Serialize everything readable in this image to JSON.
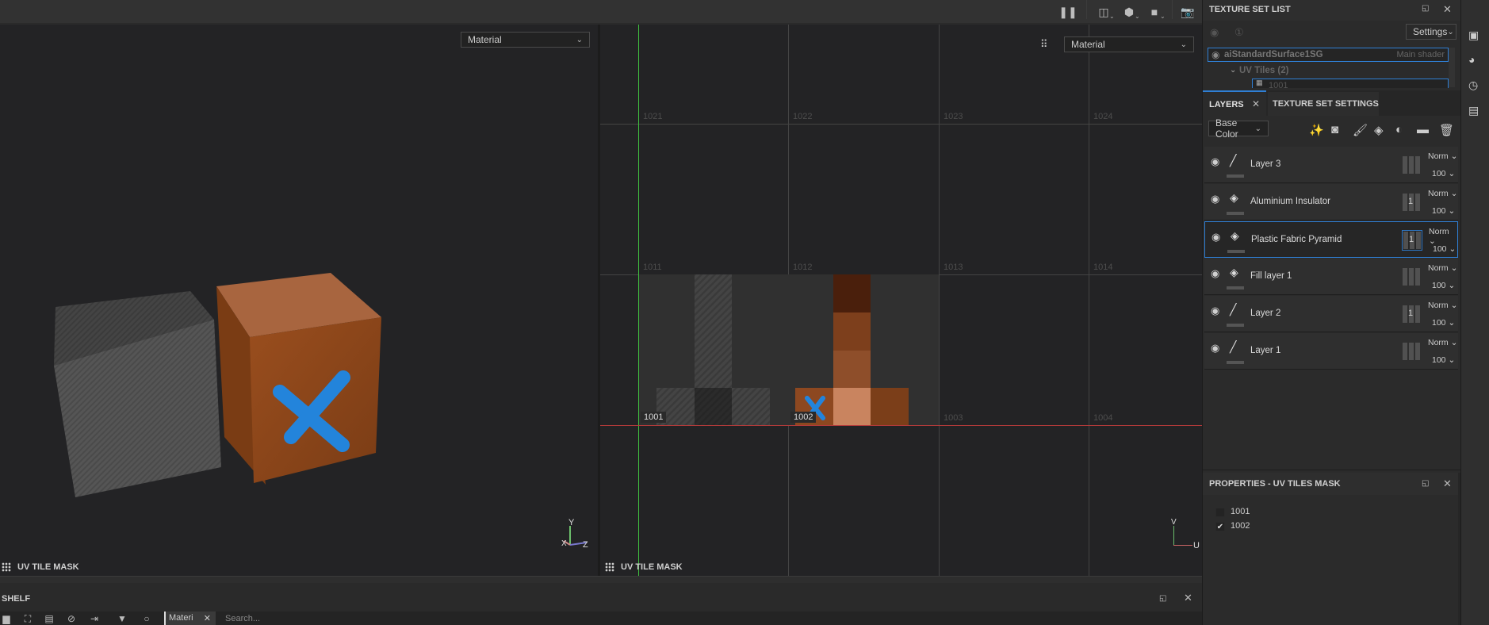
{
  "toolbar": {
    "icons": [
      "pause-icon",
      "split-view-icon",
      "display-cube-icon",
      "camera-icon",
      "screenshot-icon"
    ]
  },
  "viewport3d": {
    "channel_select": "Material",
    "footer_label": "UV TILE MASK",
    "axis": {
      "y": "Y",
      "x": "X",
      "z": "Z"
    }
  },
  "viewport2d": {
    "channel_select": "Material",
    "footer_label": "UV TILE MASK",
    "axis": {
      "v": "V",
      "u": "U"
    },
    "tile_labels": [
      "1021",
      "1022",
      "1023",
      "1024",
      "1011",
      "1012",
      "1013",
      "1014",
      "1001",
      "1002",
      "1003",
      "1004"
    ],
    "active_tiles": [
      "1001",
      "1002"
    ]
  },
  "texture_set_list": {
    "title": "TEXTURE SET LIST",
    "settings_label": "Settings",
    "item_name": "aiStandardSurface1SG",
    "item_shader": "Main shader",
    "uv_tiles_label": "UV Tiles (2)",
    "uv_tile_first": "1001"
  },
  "tabs": {
    "layers": "LAYERS",
    "texture_set_settings": "TEXTURE SET SETTINGS"
  },
  "layers_panel": {
    "channel_select": "Base Color",
    "layers": [
      {
        "name": "Layer 3",
        "type": "paint",
        "blend": "Norm",
        "opacity": "100",
        "mask_badge": "",
        "selected": false
      },
      {
        "name": "Aluminium Insulator",
        "type": "fill",
        "blend": "Norm",
        "opacity": "100",
        "mask_badge": "1",
        "selected": false
      },
      {
        "name": "Plastic Fabric Pyramid",
        "type": "fill",
        "blend": "Norm",
        "opacity": "100",
        "mask_badge": "1",
        "selected": true
      },
      {
        "name": "Fill layer 1",
        "type": "fill",
        "blend": "Norm",
        "opacity": "100",
        "mask_badge": "",
        "selected": false
      },
      {
        "name": "Layer 2",
        "type": "paint",
        "blend": "Norm",
        "opacity": "100",
        "mask_badge": "1",
        "selected": false
      },
      {
        "name": "Layer 1",
        "type": "paint",
        "blend": "Norm",
        "opacity": "100",
        "mask_badge": "",
        "selected": false
      }
    ]
  },
  "properties": {
    "title": "PROPERTIES - UV TILES MASK",
    "tiles": [
      {
        "label": "1001",
        "checked": false
      },
      {
        "label": "1002",
        "checked": true
      }
    ]
  },
  "shelf": {
    "title": "SHELF",
    "filter_tag": "Materi",
    "search_placeholder": "Search..."
  },
  "colors": {
    "accent": "#2f7fd5",
    "u_axis": "#c0392b",
    "v_axis": "#2ecc40"
  }
}
